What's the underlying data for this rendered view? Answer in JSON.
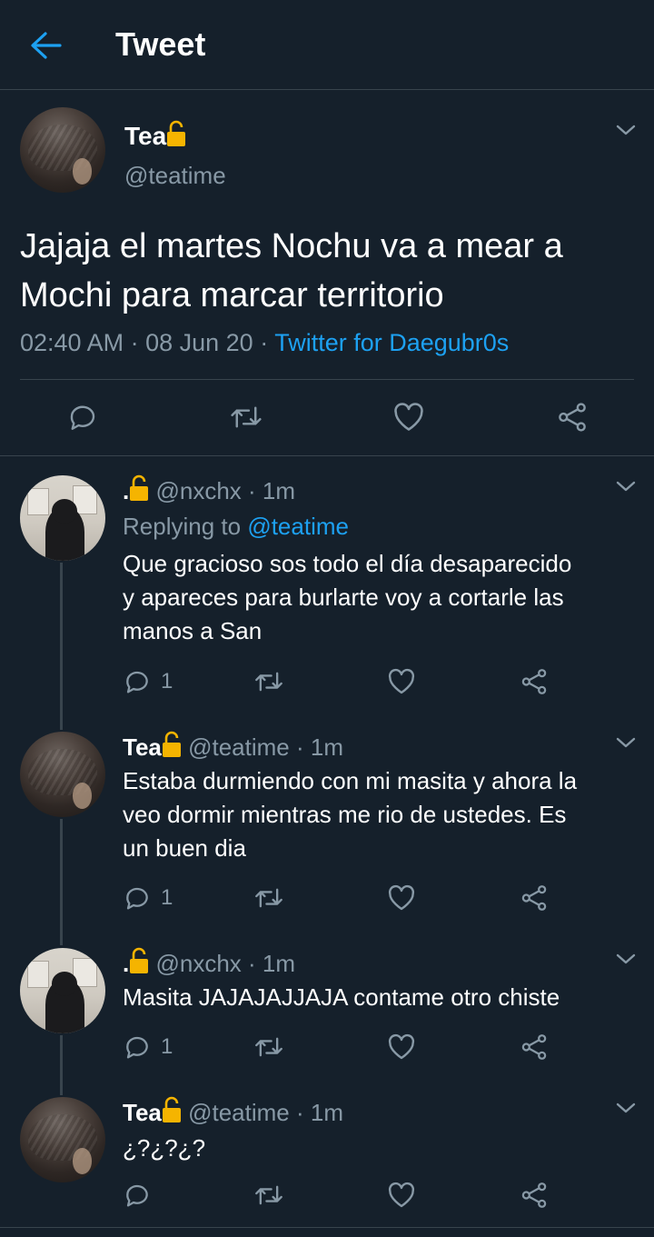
{
  "header": {
    "title": "Tweet"
  },
  "main_tweet": {
    "name": "Tea",
    "handle": "@teatime",
    "text_line1": "Jajaja el martes Nochu va a mear a",
    "text_line2": "Mochi para marcar territorio",
    "time": "02:40 AM",
    "sep1": " · ",
    "date": "08 Jun 20",
    "sep2": " · ",
    "source": "Twitter for Daegubr0s"
  },
  "replies": [
    {
      "name": ".",
      "handle": "@nxchx",
      "time": "· 1m",
      "replying_prefix": "Replying to ",
      "replying_to": "@teatime",
      "lines": [
        "Que gracioso sos todo el día desaparecido",
        "y apareces para burlarte voy a cortarle las",
        "manos a San"
      ],
      "reply_count": "1"
    },
    {
      "name": "Tea",
      "handle": "@teatime",
      "time": "· 1m",
      "lines": [
        "Estaba durmiendo con mi masita y ahora la",
        "veo dormir mientras me rio de ustedes. Es",
        "un buen dia"
      ],
      "reply_count": "1"
    },
    {
      "name": ".",
      "handle": "@nxchx",
      "time": "· 1m",
      "lines": [
        "Masita JAJAJAJJAJA contame otro chiste"
      ],
      "reply_count": "1"
    },
    {
      "name": "Tea",
      "handle": "@teatime",
      "time": "· 1m",
      "lines": [
        "¿?¿?¿?"
      ],
      "reply_count": ""
    }
  ],
  "colors": {
    "background": "#15202b",
    "accent": "#1da1f2",
    "muted": "#8899a6",
    "divider": "#38444d",
    "lock": "#f5b400"
  },
  "icons": [
    "back-arrow-icon",
    "lock-icon",
    "chevron-down-icon",
    "reply-icon",
    "retweet-icon",
    "like-icon",
    "share-icon"
  ]
}
